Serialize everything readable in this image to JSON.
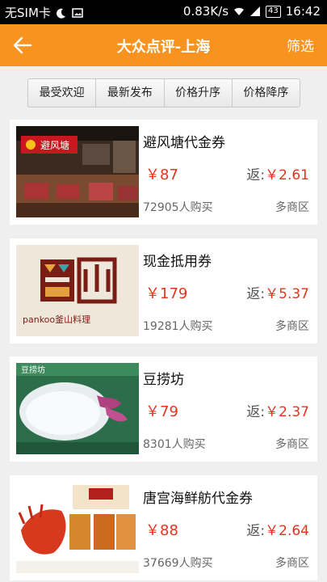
{
  "status_bar": {
    "carrier": "无SIM卡",
    "speed": "0.83K/s",
    "battery": "43",
    "time": "16:42"
  },
  "header": {
    "title": "大众点评-上海",
    "filter_label": "筛选"
  },
  "sort_tabs": [
    "最受欢迎",
    "最新发布",
    "价格升序",
    "价格降序"
  ],
  "deals": [
    {
      "name": "避风塘代金券",
      "price": "￥87",
      "rebate_label": "返:",
      "rebate_value": "￥2.61",
      "sold": "72905人购买",
      "area": "多商区",
      "logo_text": "避风塘"
    },
    {
      "name": "现金抵用券",
      "price": "￥179",
      "rebate_label": "返:",
      "rebate_value": "￥5.37",
      "sold": "19281人购买",
      "area": "多商区",
      "logo_text": "pankoo釜山料理"
    },
    {
      "name": "豆捞坊",
      "price": "￥79",
      "rebate_label": "返:",
      "rebate_value": "￥2.37",
      "sold": "8301人购买",
      "area": "多商区",
      "logo_text": "豆捞坊"
    },
    {
      "name": "唐宫海鲜舫代金券",
      "price": "￥88",
      "rebate_label": "返:",
      "rebate_value": "￥2.64",
      "sold": "37669人购买",
      "area": "多商区",
      "logo_text": ""
    }
  ],
  "colors": {
    "accent": "#f7931e",
    "price": "#e8331c"
  }
}
